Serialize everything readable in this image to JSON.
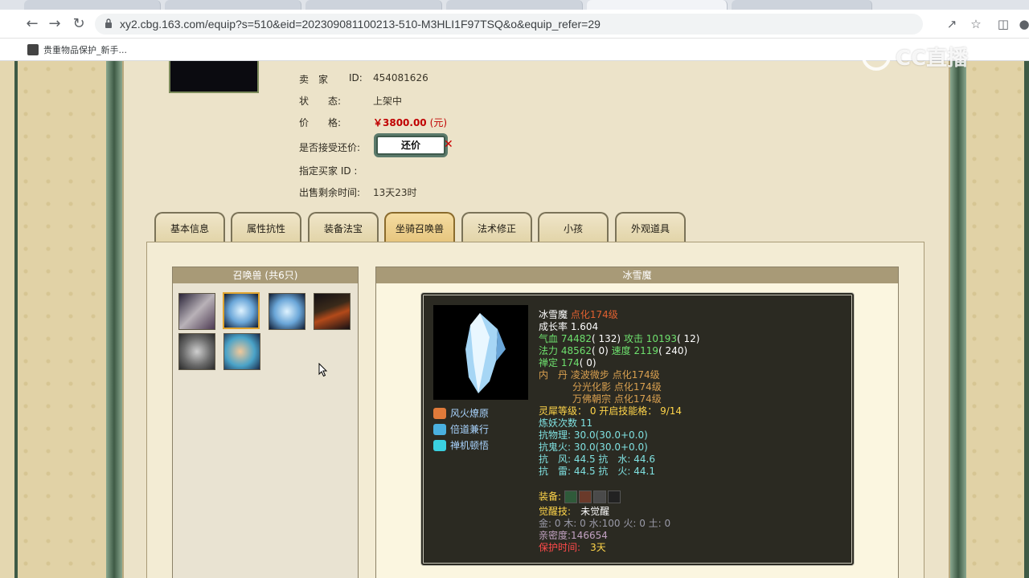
{
  "browser": {
    "url": "xy2.cbg.163.com/equip?s=510&eid=202309081100213-510-M3HLI1F97TSQ&o&equip_refer=29",
    "bookmark": "贵重物品保护_新手..."
  },
  "watermark": "CC直播",
  "seller": {
    "seller_label": "卖　家",
    "id_label": "ID:",
    "id_value": "454081626",
    "status_label": "状　　态:",
    "status_value": "上架中",
    "price_label": "价　　格:",
    "price_value": "￥3800.00",
    "price_unit": "(元)",
    "bargain_label": "是否接受还价:",
    "bargain_button": "还价",
    "buyer_label": "指定买家 ID :",
    "remaining_label": "出售剩余时间:",
    "remaining_value": "13天23时"
  },
  "tabs": [
    "基本信息",
    "属性抗性",
    "装备法宝",
    "坐骑召唤兽",
    "法术修正",
    "小孩",
    "外观道具"
  ],
  "active_tab": "坐骑召唤兽",
  "summons": {
    "header": "召唤兽 (共6只)",
    "count": 6
  },
  "detail": {
    "header": "冰雪魔",
    "name": "冰雪魔",
    "level": "点化174级",
    "growth": "成长率 1.604",
    "hp_label": "气血",
    "hp": "74482",
    "hp_extra": "( 132)",
    "atk_label": "攻击",
    "atk": "10193",
    "atk_extra": "( 12)",
    "mp_label": "法力",
    "mp": "48562",
    "mp_extra": "( 0)",
    "spd_label": "速度",
    "spd": "2119",
    "spd_extra": "( 240)",
    "focus_label": "禅定",
    "focus": "174",
    "focus_extra": "( 0)",
    "neidan_label": "内　丹",
    "neidan": [
      {
        "name": "凌波微步",
        "level": "点化174级"
      },
      {
        "name": "分光化影",
        "level": "点化174级"
      },
      {
        "name": "万佛朝宗",
        "level": "点化174级"
      }
    ],
    "lingxi": "灵犀等级： 0 开启技能格： 9/14",
    "refine": "炼妖次数 11",
    "res_phys": "抗物理: 30.0(30.0+0.0)",
    "res_ghost": "抗鬼火: 30.0(30.0+0.0)",
    "res_wind": "抗　风: 44.5 抗　水: 44.6",
    "res_thunder": "抗　雷: 44.5 抗　火: 44.1",
    "equip_label": "装备:",
    "awaken_label": "觉醒技:",
    "awaken_value": "未觉醒",
    "elements": "金: 0 木: 0 水:100 火: 0 土: 0",
    "intimacy": "亲密度:146654",
    "protect_label": "保护时间:",
    "protect_value": "3天",
    "skills": [
      "风火燎原",
      "倍道兼行",
      "禅机顿悟"
    ]
  },
  "colors": {
    "price": "#c00000",
    "panel_header": "#a89a77",
    "detail_bg": "#2b2a22",
    "active_tab": "#e6c57e"
  }
}
